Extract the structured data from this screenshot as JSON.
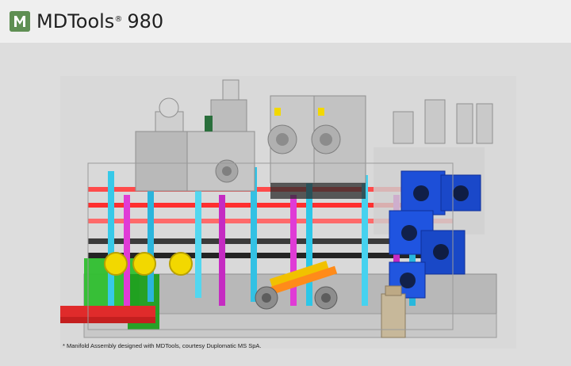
{
  "app": {
    "name": "MDTools",
    "registered": "®",
    "version": "980"
  },
  "image": {
    "caption": "* Manifold Assembly designed with MDTools, courtesy Duplomatic MS SpA."
  },
  "colors": {
    "brand_green": "#5f8f53",
    "header_bg": "#efefef",
    "viewport_bg": "#dddddd"
  }
}
